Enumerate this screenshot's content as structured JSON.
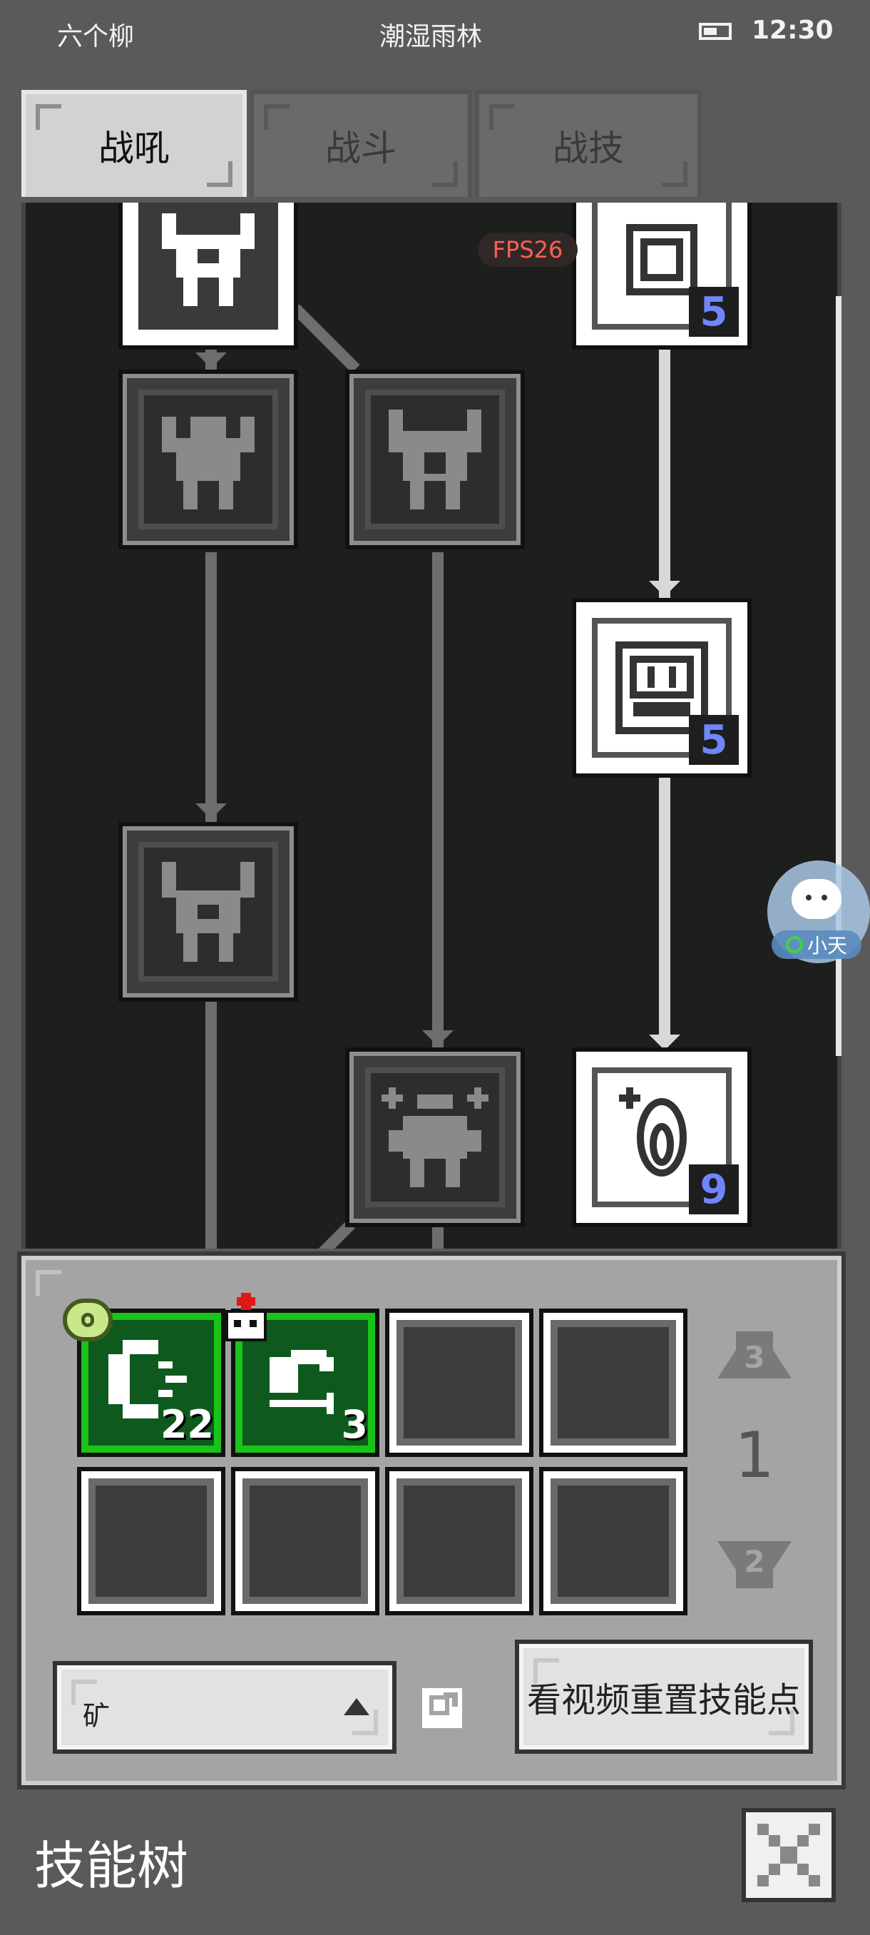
{
  "status_bar": {
    "carrier": "六个柳",
    "location": "潮湿雨林",
    "time": "12:30"
  },
  "tabs": [
    {
      "label": "战吼",
      "active": true
    },
    {
      "label": "战斗",
      "active": false
    },
    {
      "label": "战技",
      "active": false
    }
  ],
  "overlay": {
    "fps": "FPS26",
    "assistant_label": "小天"
  },
  "skill_tree": {
    "nodes": [
      {
        "name": "skill-node-top-left",
        "state": "unlocked",
        "level": null
      },
      {
        "name": "skill-node-top-right",
        "state": "unlocked",
        "level": "5"
      },
      {
        "name": "skill-node-row2-left",
        "state": "locked",
        "level": null
      },
      {
        "name": "skill-node-row2-mid",
        "state": "locked",
        "level": null
      },
      {
        "name": "skill-node-row3-right",
        "state": "unlocked",
        "level": "5"
      },
      {
        "name": "skill-node-row4-left",
        "state": "locked",
        "level": null
      },
      {
        "name": "skill-node-row5-mid",
        "state": "locked",
        "level": null
      },
      {
        "name": "skill-node-row5-right",
        "state": "unlocked",
        "level": "9"
      }
    ]
  },
  "loadout": {
    "slots": [
      {
        "filled": true,
        "count": "22",
        "badge": "ore-ring-icon"
      },
      {
        "filled": true,
        "count": "3",
        "badge": "skull-medic-icon"
      },
      {
        "filled": false
      },
      {
        "filled": false
      },
      {
        "filled": false
      },
      {
        "filled": false
      },
      {
        "filled": false
      },
      {
        "filled": false
      }
    ],
    "page_up_label": "3",
    "page_current": "1",
    "page_down_label": "2"
  },
  "filter": {
    "value": "矿"
  },
  "reset_button": {
    "label": "看视频重置技能点"
  },
  "footer": {
    "title": "技能树"
  },
  "colors": {
    "background": "#5a5a5a",
    "tree_bg": "#1d1f1d",
    "panel_bg": "#a4a4a4",
    "slot_green": "#18c418",
    "level_blue": "#6f86ff",
    "fps_red": "#ff5e54"
  }
}
